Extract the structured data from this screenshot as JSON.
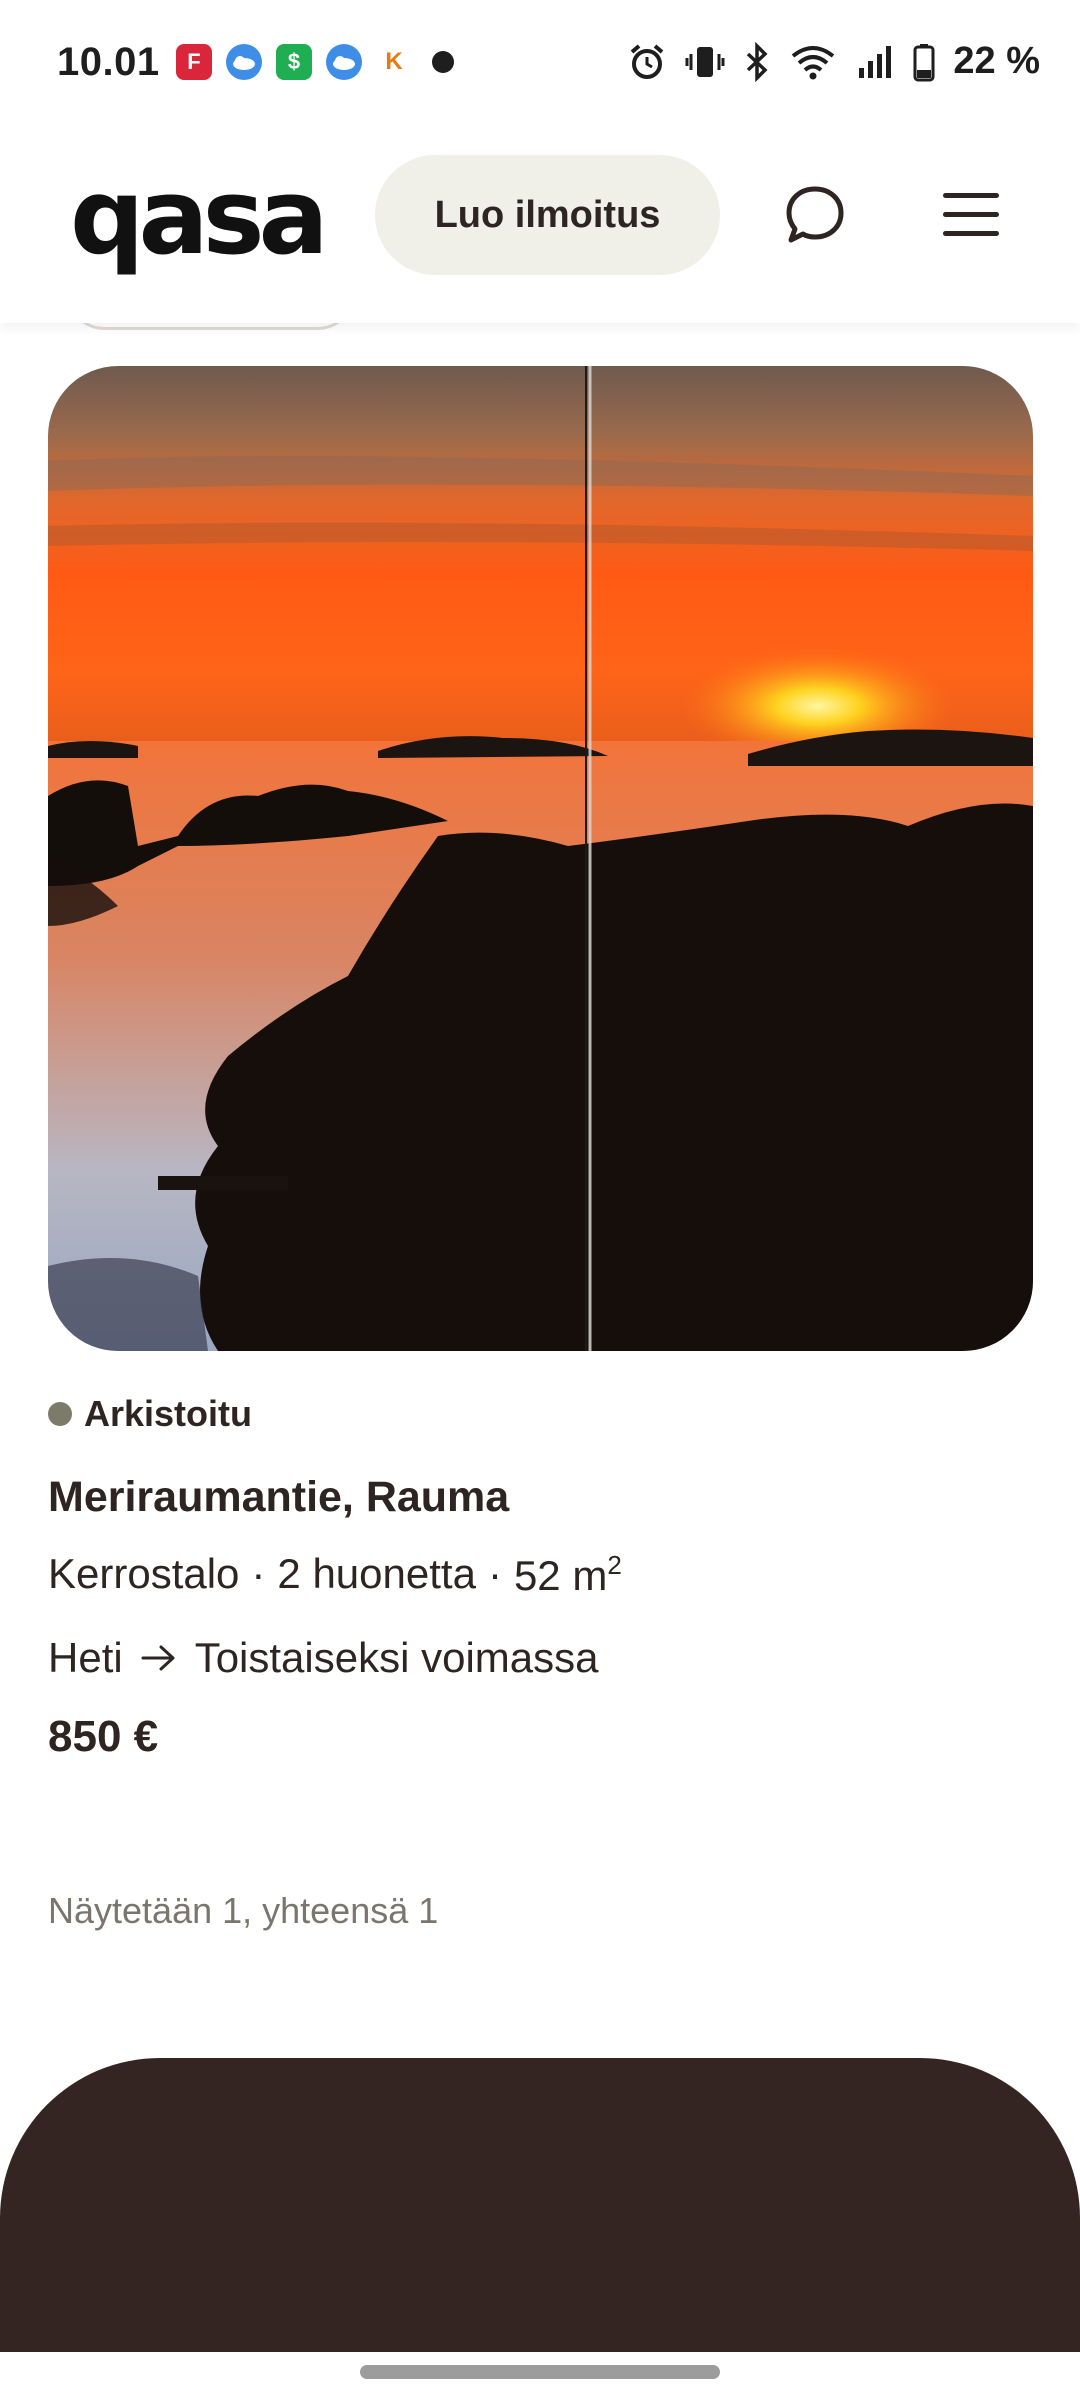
{
  "status_bar": {
    "time": "10.01",
    "notification_icons": [
      "flipboard-icon",
      "weather-icon",
      "money-app-icon",
      "weather-icon",
      "k-store-icon",
      "dot-icon"
    ],
    "notification_glyphs": [
      "F",
      "",
      "$",
      "",
      "K",
      ""
    ],
    "system_icons": [
      "alarm-icon",
      "vibrate-icon",
      "bluetooth-icon",
      "wifi-icon",
      "signal-icon",
      "battery-icon"
    ],
    "battery_percent": "22 %"
  },
  "header": {
    "logo": "qasa",
    "create_listing_label": "Luo ilmoitus",
    "chat_icon": "chat-bubble-icon",
    "menu_icon": "hamburger-menu-icon"
  },
  "listing": {
    "status": "Arkistoitu",
    "status_color": "#7c7b6a",
    "title": "Meriraumantie, Rauma",
    "home_type": "Kerrostalo",
    "rooms": "2 huonetta",
    "size": "52 m",
    "size_unit_sup": "2",
    "separator": "·",
    "move_in": "Heti",
    "arrow_icon": "arrow-right-icon",
    "move_out": "Toistaiseksi voimassa",
    "price": "850 €"
  },
  "results": {
    "count_text": "Näytetään 1, yhteensä 1"
  },
  "colors": {
    "text": "#2e2522",
    "button_bg": "#f0efe8",
    "footer_bg": "#342522",
    "muted_text": "#7b7570"
  }
}
